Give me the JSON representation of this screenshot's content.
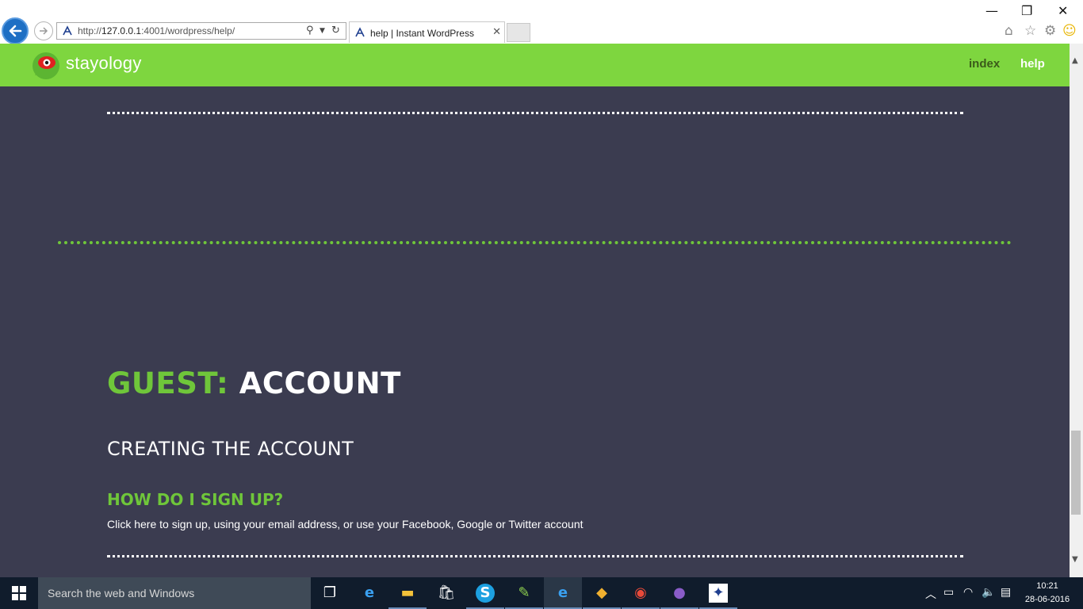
{
  "browser": {
    "url_prefix": "http://",
    "url_host": "127.0.0.1",
    "url_rest": ":4001/wordpress/help/",
    "tab_title": "help | Instant WordPress",
    "tab_close": "✕",
    "minimize": "—",
    "restore": "❐",
    "close": "✕"
  },
  "site": {
    "logo_text": "stayology",
    "nav": [
      {
        "label": "index"
      },
      {
        "label": "help"
      }
    ],
    "colors": {
      "header": "#7ed63f",
      "accent": "#6fc63a",
      "background": "#3b3c50"
    }
  },
  "content": {
    "section_title_accent": "GUEST:",
    "section_title_rest": " ACCOUNT",
    "subsection_title": "CREATING THE ACCOUNT",
    "faq": {
      "question": "HOW DO I SIGN UP?",
      "answer": "Click here to sign up, using your email address, or use your Facebook, Google or Twitter account"
    }
  },
  "taskbar": {
    "search_placeholder": "Search the web and Windows",
    "apps": [
      {
        "name": "task-view-icon",
        "glyph": "❐"
      },
      {
        "name": "edge-icon",
        "glyph": "e"
      },
      {
        "name": "file-explorer-icon",
        "glyph": "▬"
      },
      {
        "name": "store-icon",
        "glyph": "🛍"
      },
      {
        "name": "skype-icon",
        "glyph": "S"
      },
      {
        "name": "notepad-plus-icon",
        "glyph": "✎"
      },
      {
        "name": "internet-explorer-icon",
        "glyph": "e"
      },
      {
        "name": "git-icon",
        "glyph": "◆"
      },
      {
        "name": "chrome-icon",
        "glyph": "◉"
      },
      {
        "name": "github-icon",
        "glyph": "●"
      },
      {
        "name": "instant-wordpress-icon",
        "glyph": "✦"
      }
    ],
    "time": "10:21",
    "date": "28-06-2016"
  }
}
